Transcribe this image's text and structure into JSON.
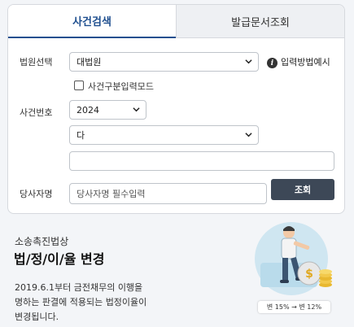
{
  "tabs": [
    {
      "label": "사건검색",
      "active": true
    },
    {
      "label": "발급문서조회",
      "active": false
    }
  ],
  "form": {
    "court_label": "법원선택",
    "court_value": "대법원",
    "help_link": "입력방법예시",
    "checkbox_label": "사건구분입력모드",
    "case_no_label": "사건번호",
    "year_value": "2024",
    "type_value": "다",
    "number_value": "",
    "party_label": "당사자명",
    "party_placeholder": "당사자명 필수입력",
    "search_button": "조회"
  },
  "promo": {
    "subtitle": "소송촉진법상",
    "title": "법/정/이/율 변경",
    "description_line1": "2019.6.1부터 금전채무의 이행을",
    "description_line2": "명하는 판결에 적용되는 법정이율이",
    "description_line3": "변경됩니다.",
    "rate_badge": "변 15% → 변 12%"
  },
  "colors": {
    "accent": "#1f4f8f",
    "button": "#3d4857",
    "background": "#f3f5f8"
  }
}
